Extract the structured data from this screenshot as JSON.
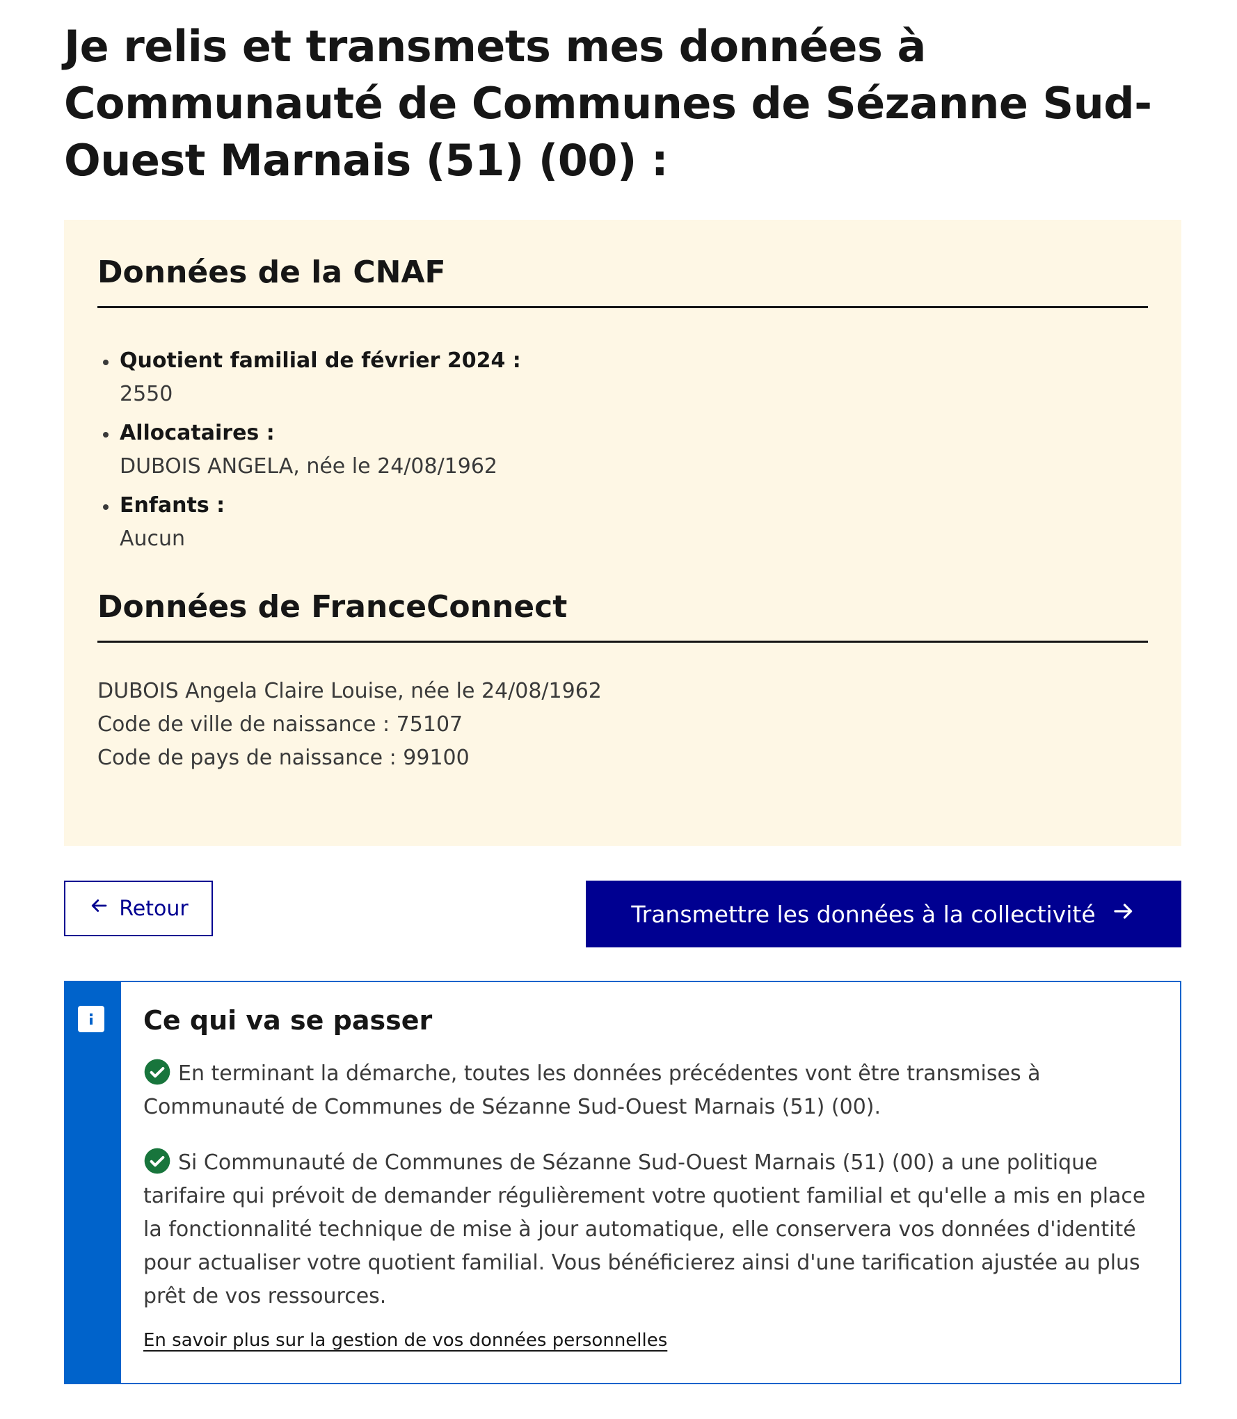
{
  "page": {
    "title": "Je relis et transmets mes données à Communauté de Communes de Sézanne Sud-Ouest Marnais (51) (00) :"
  },
  "cnaf": {
    "heading": "Données de la CNAF",
    "items": [
      {
        "label": "Quotient familial de février 2024 :",
        "value": "2550"
      },
      {
        "label": "Allocataires :",
        "value": "DUBOIS ANGELA, née le 24/08/1962"
      },
      {
        "label": "Enfants :",
        "value": "Aucun"
      }
    ]
  },
  "franceconnect": {
    "heading": "Données de FranceConnect",
    "lines": [
      "DUBOIS Angela Claire Louise, née le 24/08/1962",
      "Code de ville de naissance : 75107",
      "Code de pays de naissance : 99100"
    ]
  },
  "actions": {
    "back_label": "Retour",
    "submit_label": "Transmettre les données à la collectivité"
  },
  "info": {
    "title": "Ce qui va se passer",
    "paragraphs": [
      "En terminant la démarche, toutes les données précédentes vont être transmises à Communauté de Communes de Sézanne Sud-Ouest Marnais (51) (00).",
      "Si Communauté de Communes de Sézanne Sud-Ouest Marnais (51) (00) a une politique tarifaire qui prévoit de demander régulièrement votre quotient familial et qu'elle a mis en place la fonctionnalité technique de mise à jour automatique, elle conservera vos données d'identité pour actualiser votre quotient familial. Vous bénéficierez ainsi d'une tarification ajustée au plus prêt de vos ressources."
    ],
    "link_label": "En savoir plus sur la gestion de vos données personnelles"
  },
  "colors": {
    "primary": "#000091",
    "panel_background": "#fef7e5",
    "info_accent": "#0063cb",
    "success": "#18753c"
  },
  "icons": {
    "back": "arrow-left-icon",
    "submit": "arrow-right-icon",
    "info": "info-icon",
    "check": "check-circle-icon"
  }
}
